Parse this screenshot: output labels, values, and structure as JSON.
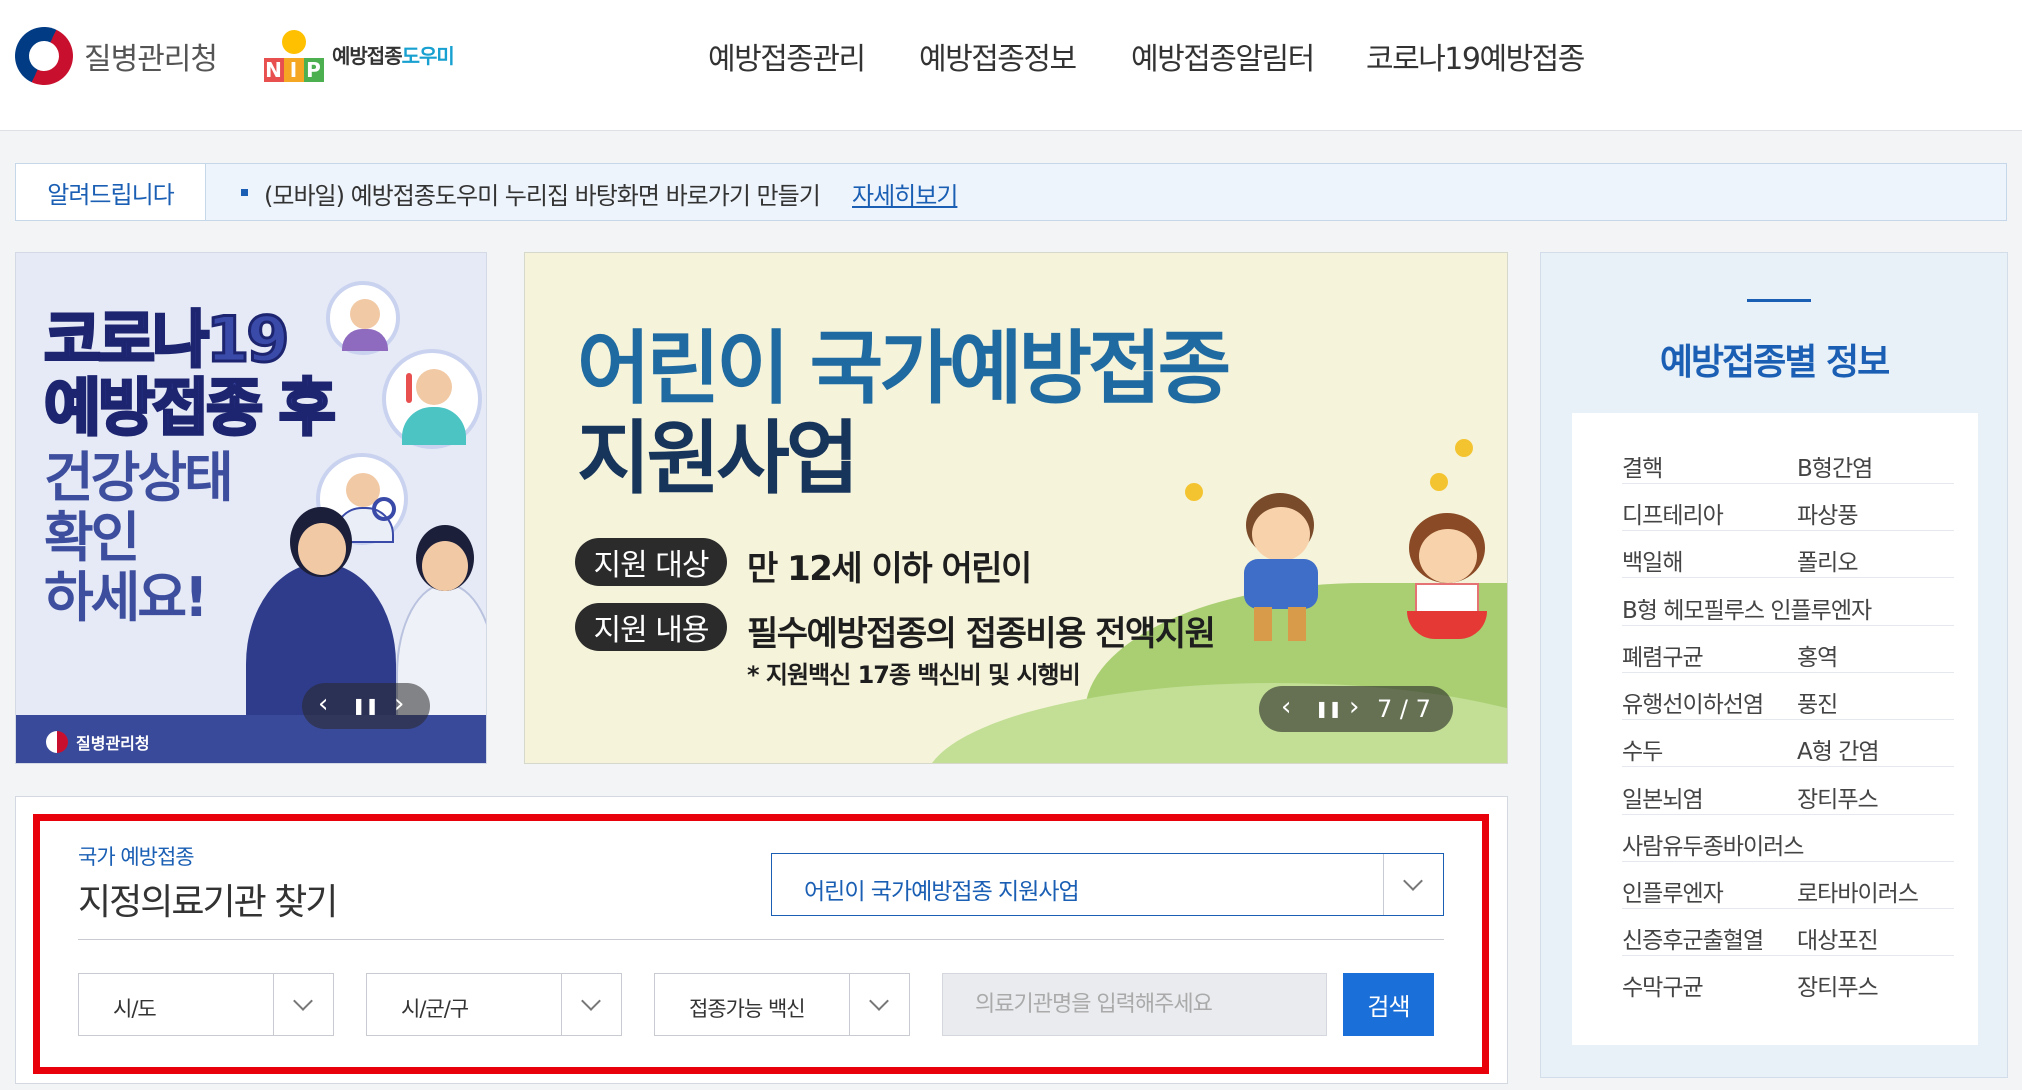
{
  "header": {
    "org_name": "질병관리청",
    "nip_letters": [
      "N",
      "I",
      "P"
    ],
    "nip_title_a": "예방접종",
    "nip_title_b": "도우미",
    "nav": [
      "예방접종관리",
      "예방접종정보",
      "예방접종알림터",
      "코로나19예방접종"
    ]
  },
  "notice": {
    "label": "알려드립니다",
    "text": "(모바일) 예방접종도우미 누리집 바탕화면 바로가기 만들기",
    "link": "자세히보기"
  },
  "banner_left": {
    "lines": [
      "코로나19",
      "예방접종 후",
      "건강상태",
      "확인",
      "하세요!"
    ],
    "footer_org": "질병관리청",
    "controls": [
      "‹",
      "❚❚",
      "›"
    ]
  },
  "banner_main": {
    "title_line1": "어린이 국가예방접종",
    "title_line2": "지원사업",
    "target_label": "지원 대상",
    "target_text": "만 12세 이하 어린이",
    "content_label": "지원 내용",
    "content_text": "필수예방접종의 접종비용 전액지원",
    "note": "* 지원백신 17종 백신비 및 시행비",
    "controls": [
      "‹",
      "❚❚",
      "›"
    ],
    "page_counter": "7 / 7"
  },
  "vaccine_info": {
    "title": "예방접종별 정보",
    "rows": [
      [
        "결핵",
        "B형간염"
      ],
      [
        "디프테리아",
        "파상풍"
      ],
      [
        "백일해",
        "폴리오"
      ],
      [
        "B형 헤모필루스 인플루엔자",
        ""
      ],
      [
        "폐렴구균",
        "홍역"
      ],
      [
        "유행선이하선염",
        "풍진"
      ],
      [
        "수두",
        "A형 간염"
      ],
      [
        "일본뇌염",
        "장티푸스"
      ],
      [
        "사람유두종바이러스",
        ""
      ],
      [
        "인플루엔자",
        "로타바이러스"
      ],
      [
        "신증후군출혈열",
        "대상포진"
      ],
      [
        "수막구균",
        "장티푸스"
      ]
    ]
  },
  "clinic_search": {
    "subtitle": "국가 예방접종",
    "title": "지정의료기관 찾기",
    "program": "어린이 국가예방접종 지원사업",
    "province": "시/도",
    "district": "시/군/구",
    "vaccine": "접종가능 백신",
    "name_placeholder": "의료기관명을 입력해주세요",
    "search_button": "검색"
  },
  "colors": {
    "brand_blue": "#1a5fb4",
    "search_button": "#1a6fd8",
    "highlight_red": "#e8000b",
    "banner_title_blue": "#1f6aa0",
    "banner_title_dark": "#17345b"
  }
}
